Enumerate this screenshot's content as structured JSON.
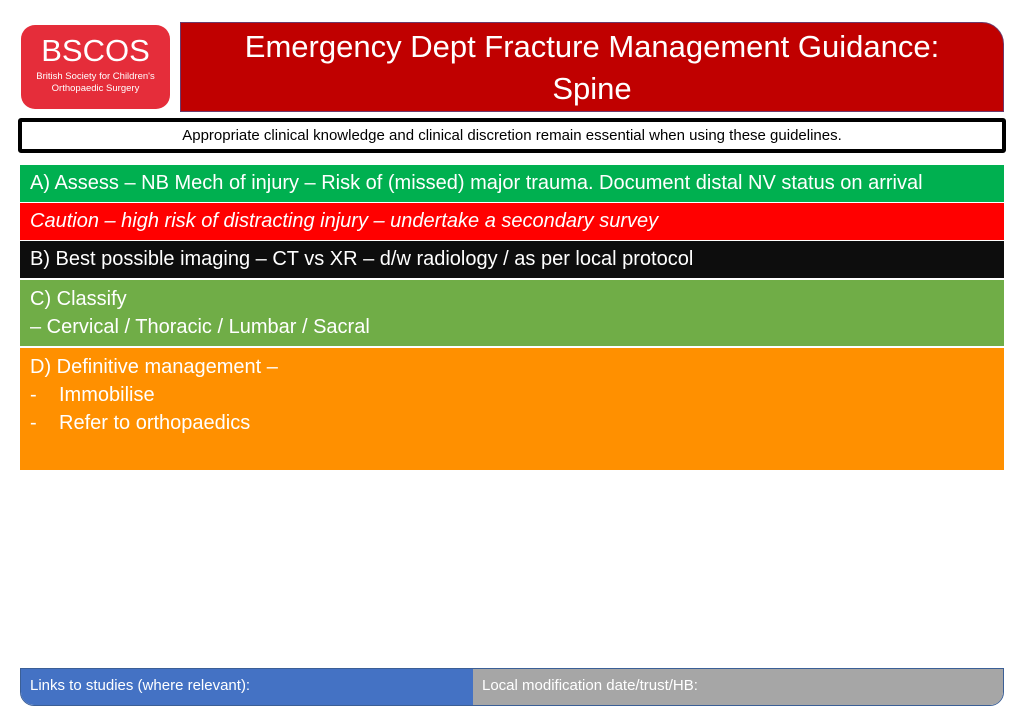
{
  "logo": {
    "brand": "BSCOS",
    "subtitle_line1": "British Society for Children's",
    "subtitle_line2": "Orthopaedic Surgery"
  },
  "header": {
    "title_line1": "Emergency Dept Fracture Management Guidance:",
    "title_line2": "Spine"
  },
  "disclaimer": "Appropriate clinical knowledge and clinical discretion remain essential when using these guidelines.",
  "sections": {
    "assess": "A) Assess – NB Mech of injury – Risk of (missed) major trauma. Document distal NV status on arrival",
    "caution": "Caution – high risk of distracting injury – undertake a secondary survey",
    "imaging": "B) Best possible imaging – CT vs XR – d/w radiology / as per local protocol",
    "classify": {
      "heading": "C) Classify",
      "detail": "– Cervical /  Thoracic / Lumbar / Sacral"
    },
    "definitive": {
      "heading": "D) Definitive management –",
      "items": [
        {
          "bullet": "-",
          "text": "Immobilise"
        },
        {
          "bullet": "-",
          "text": "Refer to orthopaedics"
        }
      ]
    }
  },
  "footer": {
    "links_label": "Links to studies (where relevant):",
    "local_label": "Local modification date/trust/HB:"
  },
  "colors": {
    "logo_red": "#e52d3a",
    "title_red": "#c00000",
    "assess_green": "#00b050",
    "caution_red": "#ff0000",
    "imaging_black": "#0d0d0d",
    "classify_green": "#70ad47",
    "definitive_orange": "#ff9000",
    "links_blue": "#4472c4",
    "local_grey": "#a6a6a6"
  }
}
